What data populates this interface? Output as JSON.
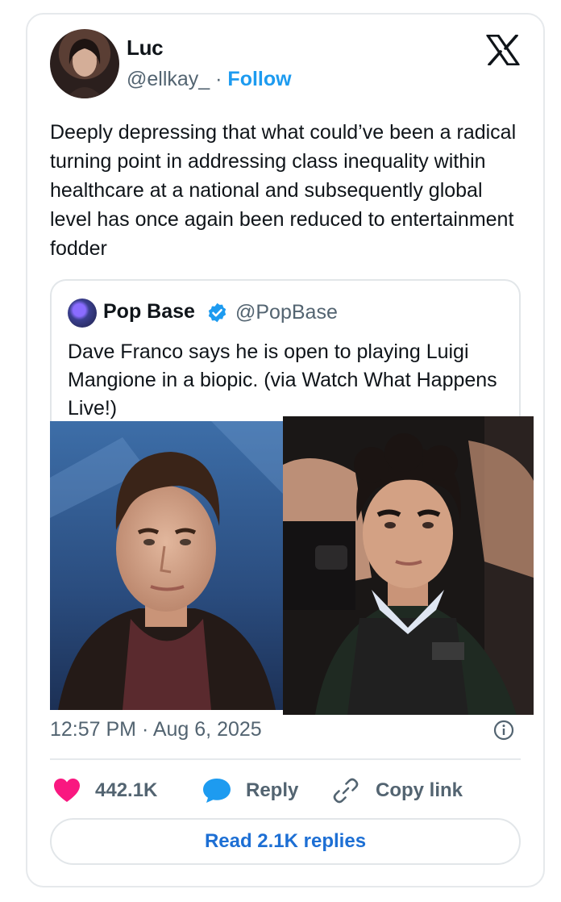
{
  "author": {
    "name": "Luc",
    "handle": "@ellkay_",
    "separator": " · ",
    "follow_label": "Follow"
  },
  "tweet": {
    "text": "Deeply depressing that what could’ve been a radical turning point in addressing class inequality within healthcare at a national and subsequently global level has once again been reduced to entertainment fodder",
    "timestamp": "12:57 PM · Aug 6, 2025"
  },
  "quote": {
    "name": "Pop Base",
    "handle": "@PopBase",
    "text": "Dave Franco says he is open to playing Luigi Mangione in a biopic. (via Watch What Happens Live!)"
  },
  "actions": {
    "likes": "442.1K",
    "reply_label": "Reply",
    "copy_label": "Copy link"
  },
  "read_replies_label": "Read 2.1K replies",
  "colors": {
    "accent": "#1d9bf0",
    "like": "#f91880",
    "muted": "#536471"
  },
  "icons": {
    "logo": "x-logo",
    "verified": "verified-badge-icon",
    "info": "info-icon",
    "like": "heart-icon",
    "reply": "reply-bubble-icon",
    "copy": "link-icon"
  }
}
